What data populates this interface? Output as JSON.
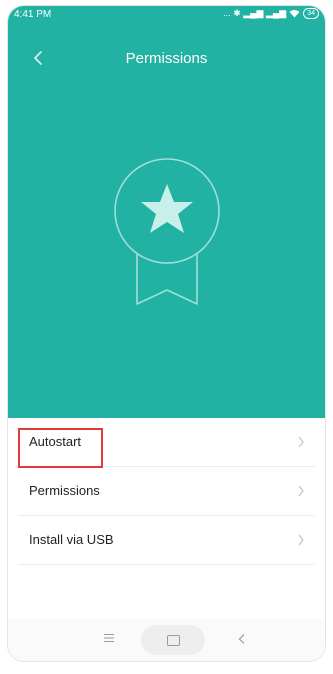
{
  "status_bar": {
    "time": "4:41 PM",
    "indicators": "... ✱ ▂▄▆ ▂▄▆",
    "battery": "34"
  },
  "header": {
    "title": "Permissions",
    "back_icon": "chevron-left-icon"
  },
  "hero": {
    "icon": "star-award-icon",
    "background_color": "#22b2a4"
  },
  "menu": {
    "items": [
      {
        "label": "Autostart",
        "highlighted": true
      },
      {
        "label": "Permissions",
        "highlighted": false
      },
      {
        "label": "Install via USB",
        "highlighted": false
      }
    ]
  },
  "nav_bar": {
    "icons": [
      "menu-icon",
      "home-icon",
      "back-icon"
    ]
  },
  "colors": {
    "accent": "#22b2a4",
    "highlight_border": "#e0393e"
  }
}
